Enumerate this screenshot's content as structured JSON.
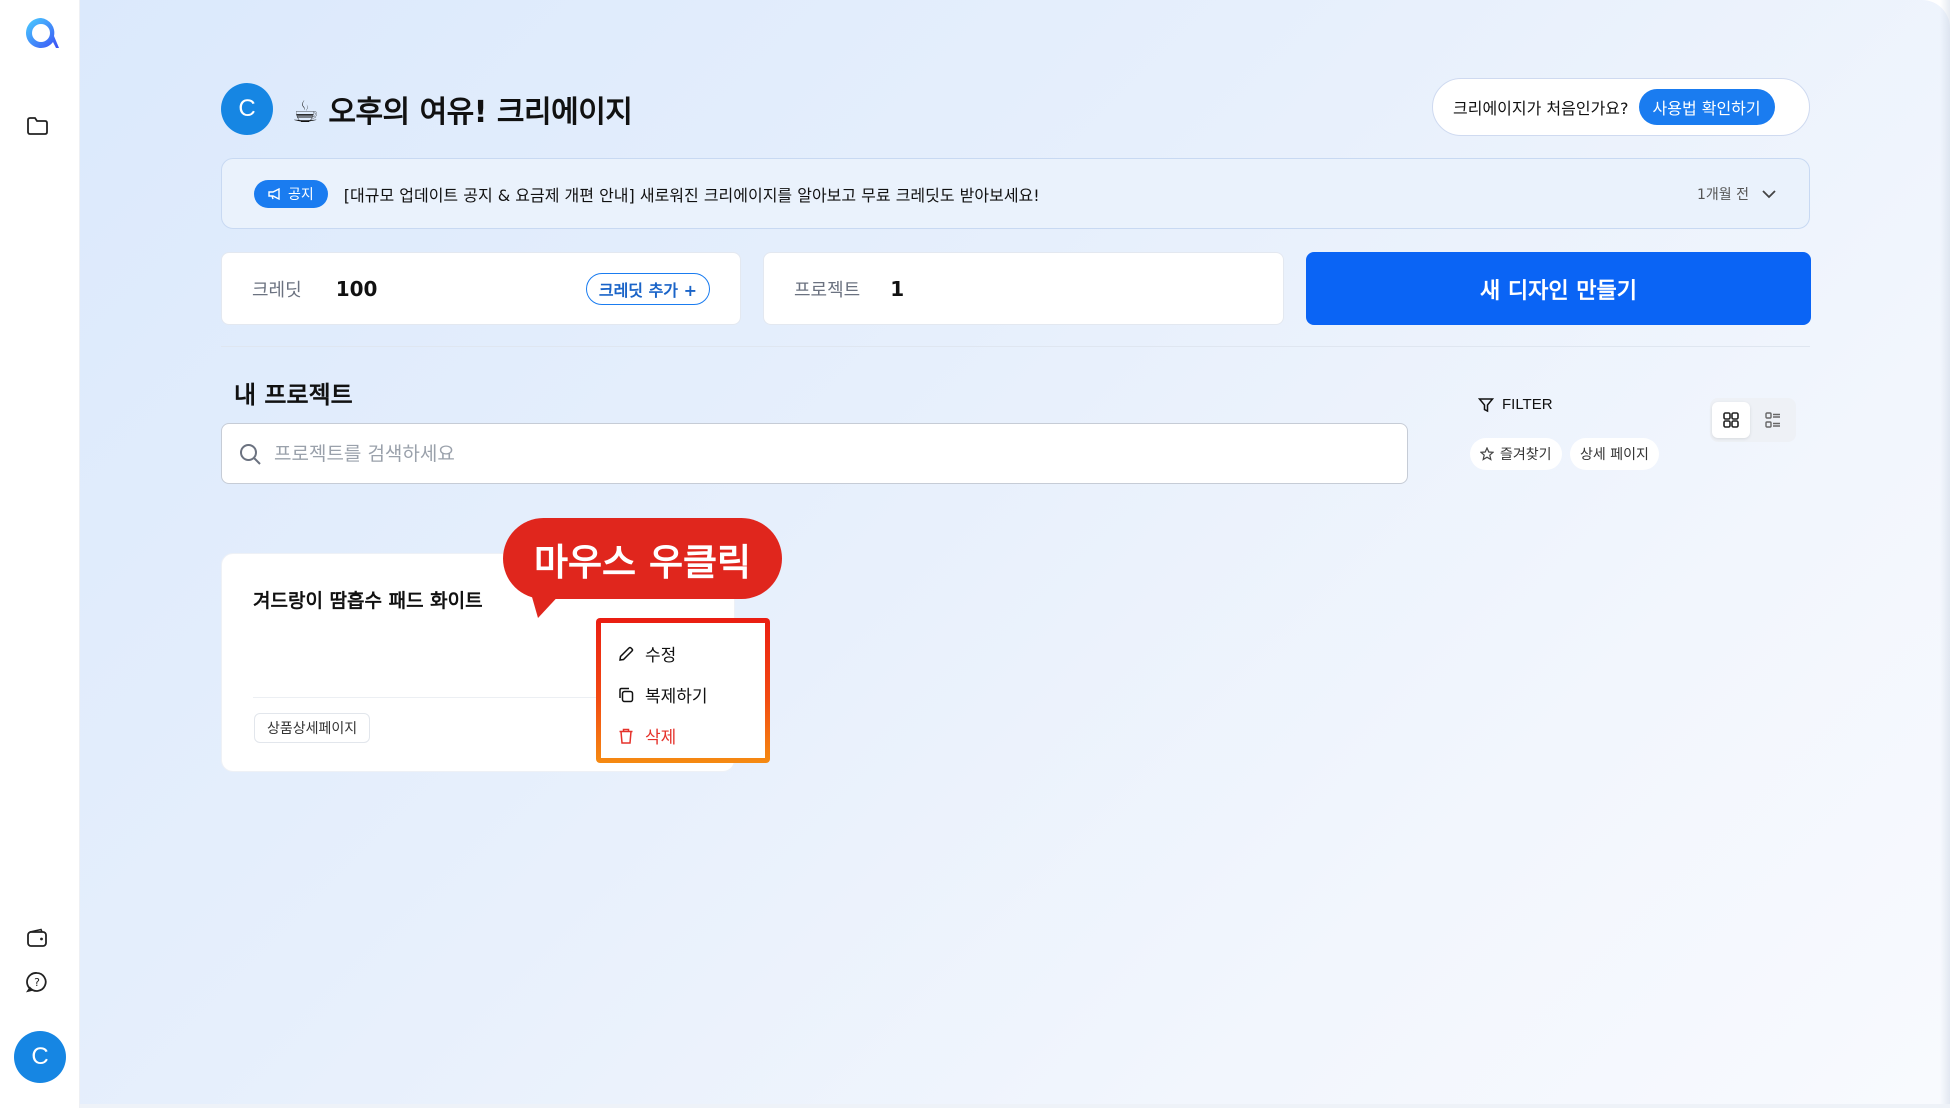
{
  "sidebar": {
    "logo_icon": "app-logo",
    "items": [
      {
        "icon": "folder-icon"
      },
      {
        "icon": "wallet-icon"
      },
      {
        "icon": "help-chat-icon"
      }
    ],
    "avatar_initial": "C"
  },
  "header": {
    "avatar_initial": "C",
    "greeting": "☕ 오후의 여유! 크리에이지",
    "help_text": "크리에이지가 처음인가요?",
    "help_button": "사용법 확인하기"
  },
  "notice": {
    "badge": "공지",
    "text": "[대규모 업데이트 공지 & 요금제 개편 안내] 새로워진 크리에이지를 알아보고 무료 크레딧도 받아보세요!",
    "time": "1개월 전"
  },
  "stats": {
    "credit_label": "크레딧",
    "credit_value": "100",
    "credit_add": "크레딧 추가 +",
    "project_label": "프로젝트",
    "project_value": "1"
  },
  "new_design_button": "새 디자인 만들기",
  "projects_section": {
    "title": "내 프로젝트",
    "search_placeholder": "프로젝트를 검색하세요",
    "filter_label": "FILTER",
    "chips": [
      "즐겨찾기",
      "상세 페이지"
    ]
  },
  "project_card": {
    "title": "겨드랑이 땀흡수 패드 화이트",
    "tag": "상품상세페이지"
  },
  "annotation": {
    "bubble_text": "마우스 우클릭"
  },
  "context_menu": {
    "items": [
      {
        "label": "수정",
        "icon": "pencil-icon"
      },
      {
        "label": "복제하기",
        "icon": "copy-icon"
      },
      {
        "label": "삭제",
        "icon": "trash-icon"
      }
    ]
  },
  "colors": {
    "primary": "#0a64f5",
    "accent": "#1a7cf0",
    "danger": "#e5322b",
    "annotation": "#e0261d"
  }
}
